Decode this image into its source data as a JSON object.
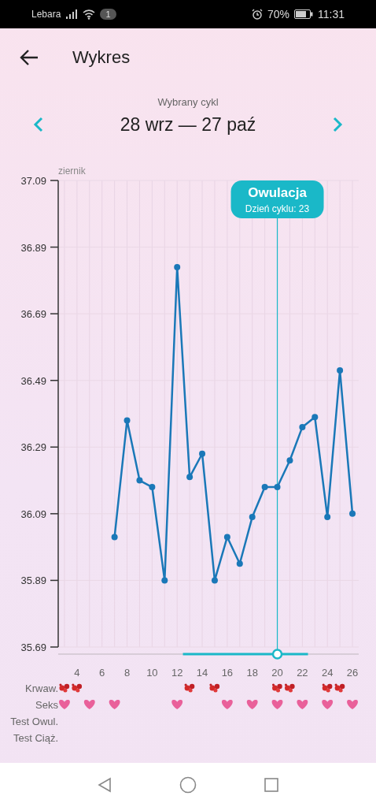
{
  "status_bar": {
    "carrier": "Lebara",
    "notification_count": "1",
    "battery": "70%",
    "time": "11:31"
  },
  "header": {
    "title": "Wykres"
  },
  "cycle": {
    "caption": "Wybrany cykl",
    "range": "28 wrz — 27 paź"
  },
  "chart": {
    "month_label": "ziernik",
    "tooltip_subtitle": "Dzień cyklu: 23",
    "chart_data": {
      "type": "line",
      "x": [
        7,
        8,
        9,
        10,
        11,
        12,
        13,
        14,
        15,
        16,
        17,
        18,
        19,
        20,
        21,
        22,
        23,
        24,
        25,
        26
      ],
      "series": [
        {
          "color": "#1a78b8",
          "marker": "o",
          "values": [
            36.02,
            36.37,
            36.19,
            36.17,
            35.89,
            36.83,
            36.2,
            36.27,
            35.89,
            36.02,
            35.94,
            36.08,
            36.17,
            36.17,
            36.25,
            36.35,
            36.38,
            36.08,
            36.52,
            36.09
          ]
        }
      ],
      "xlim": [
        2.5,
        26.5
      ],
      "ylim": [
        35.69,
        37.09
      ],
      "grid": true,
      "xticks": [
        4,
        6,
        8,
        10,
        12,
        14,
        16,
        18,
        20,
        22,
        24,
        26
      ],
      "yticks": [
        {
          "value": 35.69,
          "label": "35.69"
        },
        {
          "value": 35.89,
          "label": "35.89"
        },
        {
          "value": 36.09,
          "label": "36.09"
        },
        {
          "value": 36.29,
          "label": "36.29"
        },
        {
          "value": 36.49,
          "label": "36.49"
        },
        {
          "value": 36.69,
          "label": "36.69"
        },
        {
          "value": 36.89,
          "label": "36.89"
        },
        {
          "value": 37.09,
          "label": "37.09"
        }
      ],
      "ref_lines": [
        {
          "axis": "x",
          "value": 20
        }
      ],
      "annotations": [
        "Owulacja"
      ]
    },
    "marker_rows": [
      {
        "label": "Krwaw.",
        "kind": "blood",
        "marks": [
          true,
          true,
          false,
          false,
          false,
          false,
          false,
          false,
          false,
          false,
          true,
          false,
          true,
          false,
          false,
          false,
          false,
          true,
          true,
          false,
          false,
          true,
          true,
          false
        ]
      },
      {
        "label": "Seks",
        "kind": "heart",
        "marks": [
          true,
          false,
          true,
          false,
          true,
          false,
          false,
          false,
          false,
          true,
          false,
          false,
          false,
          true,
          false,
          true,
          false,
          true,
          false,
          true,
          false,
          true,
          false,
          true
        ]
      },
      {
        "label": "Test Owul."
      },
      {
        "label": "Test Ciąż."
      }
    ]
  }
}
